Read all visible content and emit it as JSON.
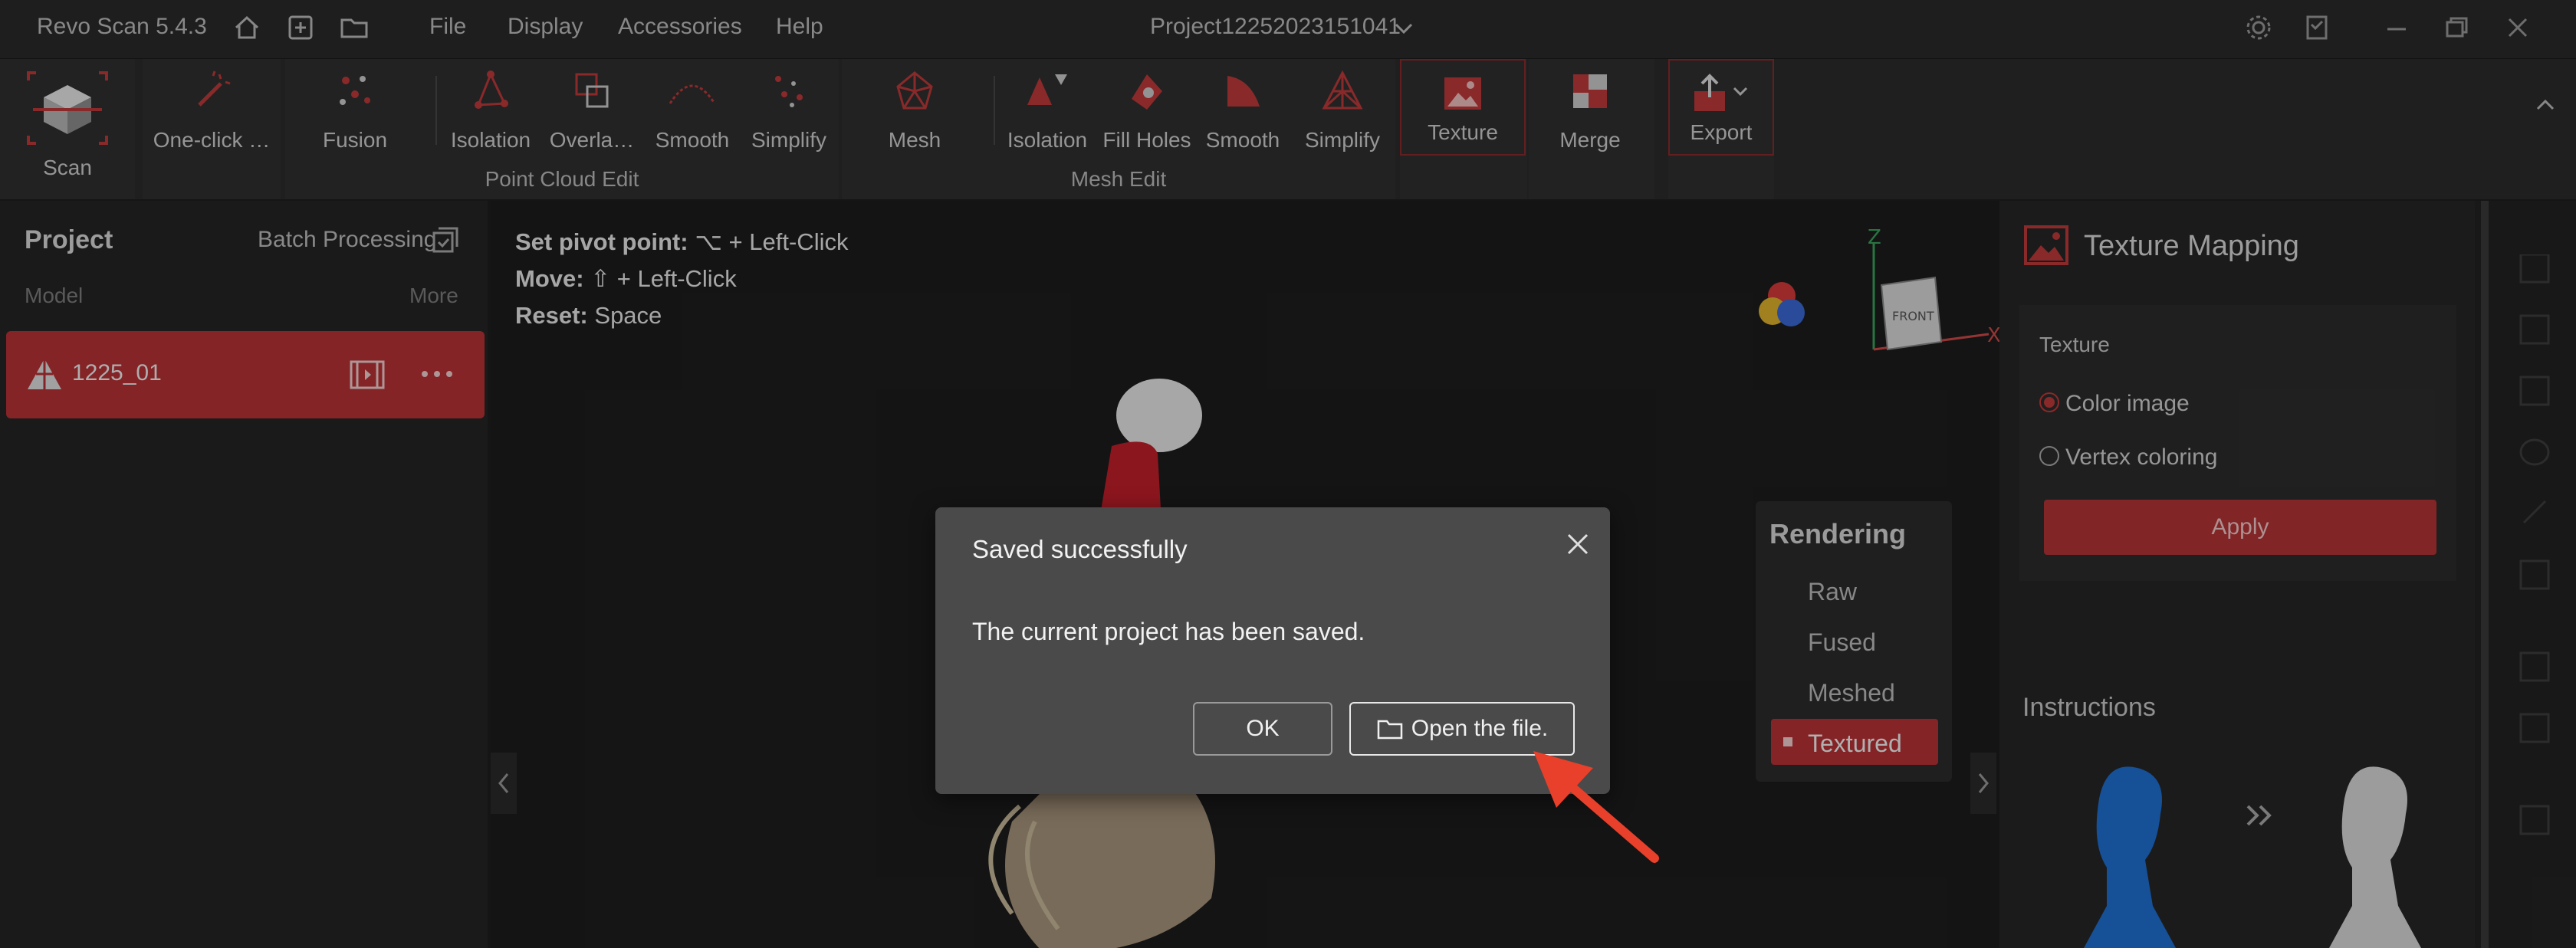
{
  "app": {
    "title": "Revo Scan 5.4.3",
    "project_name": "Project12252023151041"
  },
  "menu": [
    "File",
    "Display",
    "Accessories",
    "Help"
  ],
  "ribbon": {
    "scan": "Scan",
    "one_click": "One-click …",
    "fusion": "Fusion",
    "pc_isolation": "Isolation",
    "overlap": "Overla…",
    "pc_smooth": "Smooth",
    "pc_simplify": "Simplify",
    "point_cloud_edit": "Point Cloud Edit",
    "mesh": "Mesh",
    "mesh_isolation": "Isolation",
    "fill_holes": "Fill Holes",
    "mesh_smooth": "Smooth",
    "mesh_simplify": "Simplify",
    "mesh_edit": "Mesh Edit",
    "texture": "Texture",
    "merge": "Merge",
    "export": "Export"
  },
  "left_panel": {
    "title": "Project",
    "batch": "Batch Processing",
    "model_label": "Model",
    "more": "More",
    "model_item": "1225_01"
  },
  "viewport": {
    "hint_pivot_label": "Set pivot point:",
    "hint_pivot_value": "⌥ + Left-Click",
    "hint_move_label": "Move:",
    "hint_move_value": "⇧ + Left-Click",
    "hint_reset_label": "Reset:",
    "hint_reset_value": "Space",
    "axis_z": "Z",
    "axis_x": "X",
    "cube_face": "FRONT"
  },
  "rendering": {
    "title": "Rendering",
    "options": [
      "Raw",
      "Fused",
      "Meshed",
      "Textured"
    ],
    "selected": "Textured"
  },
  "texture_panel": {
    "title": "Texture Mapping",
    "section": "Texture",
    "option_color": "Color image",
    "option_vertex": "Vertex coloring",
    "apply": "Apply",
    "instructions": "Instructions"
  },
  "dialog": {
    "title": "Saved successfully",
    "message": "The current project has been saved.",
    "ok": "OK",
    "open_file": "Open the file."
  },
  "colors": {
    "accent": "#c0393b",
    "arrow": "#e8402a"
  }
}
